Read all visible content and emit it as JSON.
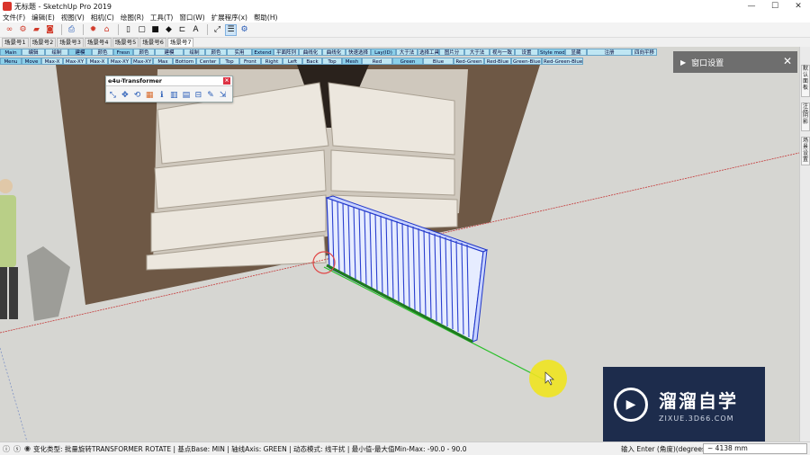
{
  "window": {
    "title": "无标题 - SketchUp Pro 2019",
    "controls": [
      "—",
      "☐",
      "✕"
    ]
  },
  "menu": [
    "文件(F)",
    "编辑(E)",
    "视图(V)",
    "相机(C)",
    "绘图(R)",
    "工具(T)",
    "窗口(W)",
    "扩展程序(x)",
    "帮助(H)"
  ],
  "scene_tabs": [
    "场景号1",
    "场景号2",
    "场景号3",
    "场景号4",
    "场景号5",
    "场景号6",
    "场景号7"
  ],
  "active_scene_index": 6,
  "overlay_strip_1": [
    "Main",
    "编辑",
    "绘制",
    "建模",
    "颜色",
    "Fresn",
    "颜色",
    "建模",
    "绘制",
    "颜色",
    "实用",
    "Extend",
    "平面阵列",
    "曲线化",
    "曲线化",
    "快速选择",
    "Lay(ID)",
    "大于法",
    "选择工具",
    "图片分",
    "大于法",
    "视与一致",
    "设置",
    "Style mode",
    "显藏",
    "注册",
    "四向平移"
  ],
  "overlay_strip_2": [
    "Menu",
    "Move",
    "Max-X",
    "Max-XY",
    "Max-X",
    "Max-XY",
    "Max-XY",
    "Max",
    "Bottom",
    "Center",
    "Top",
    "Front",
    "Right",
    "Left",
    "Back",
    "Top",
    "Mesh",
    "Red",
    "Green",
    "Blue",
    "Red-Green",
    "Red-Blue",
    "Green-Blue",
    "Red-Green-Blue"
  ],
  "transformer": {
    "title": "e4u-Transformer",
    "close": "×",
    "tools": [
      "scale-icon",
      "move-icon",
      "rotate-icon",
      "color-icon",
      "info-icon",
      "bars-icon",
      "stack-icon",
      "align-icon",
      "pencil-icon",
      "resize-icon"
    ]
  },
  "tray": {
    "title": "窗口设置",
    "arrow": "▶",
    "close": "✕"
  },
  "vertical_tabs": [
    "默认面板",
    "注释",
    "阴影",
    "场景设置"
  ],
  "watermark": {
    "brand": "溜溜自学",
    "url": "ZIXUE.3D66.COM"
  },
  "status": {
    "text": "变化类型: 批量旋转TRANSFORMER ROTATE | 基点Base: MIN | 轴线Axis: GREEN | 动态模式: 线干扰 | 最小值-最大值Min-Max: -90.0 - 90.0",
    "measure_label": "输入 Enter (角度)(degrees)",
    "measure_value": "~ 4138 mm"
  }
}
